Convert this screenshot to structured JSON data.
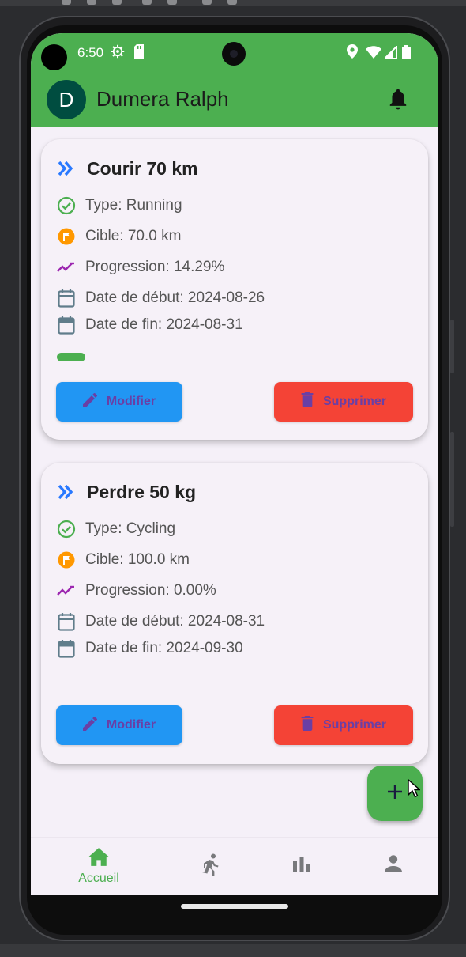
{
  "status_bar": {
    "time": "6:50",
    "icons": [
      "settings-icon",
      "sd-card-icon",
      "location-icon",
      "wifi-icon",
      "signal-icon",
      "battery-icon"
    ]
  },
  "app_bar": {
    "avatar_letter": "D",
    "user_name": "Dumera Ralph",
    "notification_icon": "bell-icon",
    "bg_color": "#4caf50"
  },
  "goals": [
    {
      "title": "Courir 70 km",
      "type": "Type: Running",
      "target": "Cible: 70.0 km",
      "progress_text": "Progression: 14.29%",
      "progress_fraction": 0.1429,
      "start": "Date de début: 2024-08-26",
      "end": "Date de fin: 2024-08-31",
      "edit_label": "Modifier",
      "delete_label": "Supprimer"
    },
    {
      "title": "Perdre 50 kg",
      "type": "Type: Cycling",
      "target": "Cible: 100.0 km",
      "progress_text": "Progression: 0.00%",
      "progress_fraction": 0.0,
      "start": "Date de début: 2024-08-31",
      "end": "Date de fin: 2024-09-30",
      "edit_label": "Modifier",
      "delete_label": "Supprimer"
    }
  ],
  "fab": {
    "icon": "add-icon"
  },
  "bottom_nav": {
    "items": [
      {
        "icon": "home-icon",
        "label": "Accueil",
        "selected": true
      },
      {
        "icon": "running-icon",
        "label": "",
        "selected": false
      },
      {
        "icon": "bar-chart-icon",
        "label": "",
        "selected": false
      },
      {
        "icon": "person-icon",
        "label": "",
        "selected": false
      }
    ]
  },
  "colors": {
    "primary": "#4caf50",
    "edit_button": "#2196f3",
    "delete_button": "#f44336",
    "button_label": "#6a3fa5",
    "title_chevron": "#2979ff",
    "type_check": "#4caf50",
    "target_flag": "#ff9800",
    "progress_trend": "#9c27b0",
    "calendar": "#607d8b"
  }
}
